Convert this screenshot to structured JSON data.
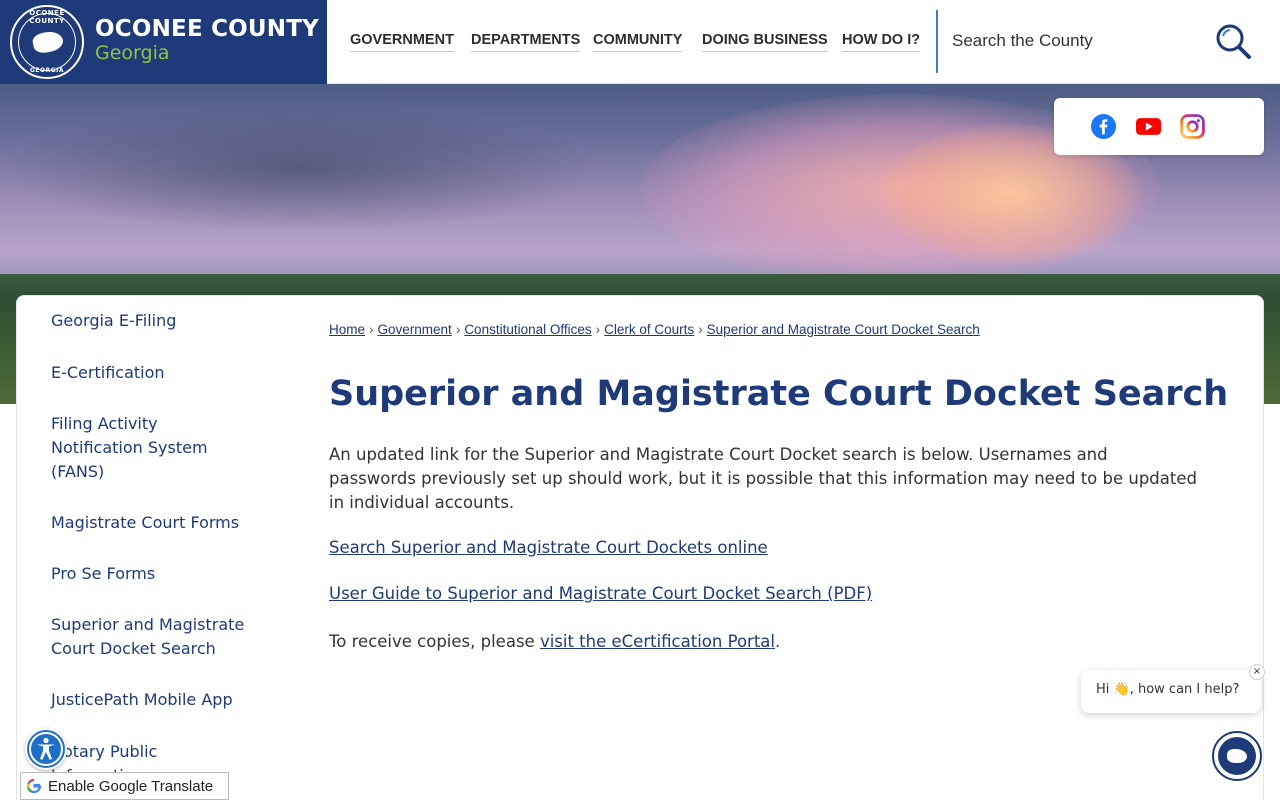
{
  "brand": {
    "name": "OCONEE COUNTY",
    "subtitle": "Georgia",
    "seal_top": "OCONEE COUNTY",
    "seal_bottom": "GEORGIA"
  },
  "nav": {
    "items": [
      "GOVERNMENT",
      "DEPARTMENTS",
      "COMMUNITY",
      "DOING BUSINESS",
      "HOW DO I?"
    ]
  },
  "search": {
    "placeholder": "Search the County"
  },
  "social": [
    "facebook-icon",
    "youtube-icon",
    "instagram-icon"
  ],
  "sidebar": {
    "items": [
      {
        "label": "Georgia E-Filing"
      },
      {
        "label": "E-Certification"
      },
      {
        "label": "Filing Activity Notification System (FANS)"
      },
      {
        "label": "Magistrate Court Forms"
      },
      {
        "label": "Pro Se Forms"
      },
      {
        "label": "Superior and Magistrate Court Docket Search"
      },
      {
        "label": "JusticePath Mobile App"
      },
      {
        "label": "Notary Public Information"
      }
    ]
  },
  "breadcrumb": [
    "Home",
    "Government",
    "Constitutional Offices",
    "Clerk of Courts",
    "Superior and Magistrate Court Docket Search"
  ],
  "page": {
    "title": "Superior and Magistrate Court Docket Search",
    "intro": "An updated link for the Superior and Magistrate Court Docket search is below. Usernames and passwords previously set up should work, but it is possible that this information may need to be updated in individual accounts.",
    "link1": "Search Superior and Magistrate Court Dockets online",
    "link2": "User Guide to Superior and Magistrate Court Docket Search (PDF)",
    "copies_prefix": "To receive copies, please ",
    "copies_link": "visit the eCertification Portal",
    "copies_suffix": "."
  },
  "chat": {
    "greeting": "Hi 👋, how can I help?",
    "close": "×"
  },
  "translate": {
    "label": "Enable Google Translate"
  },
  "colors": {
    "brand_navy": "#1e3a78",
    "brand_green": "#8dc63f",
    "accent_blue": "#3d7cc9"
  }
}
